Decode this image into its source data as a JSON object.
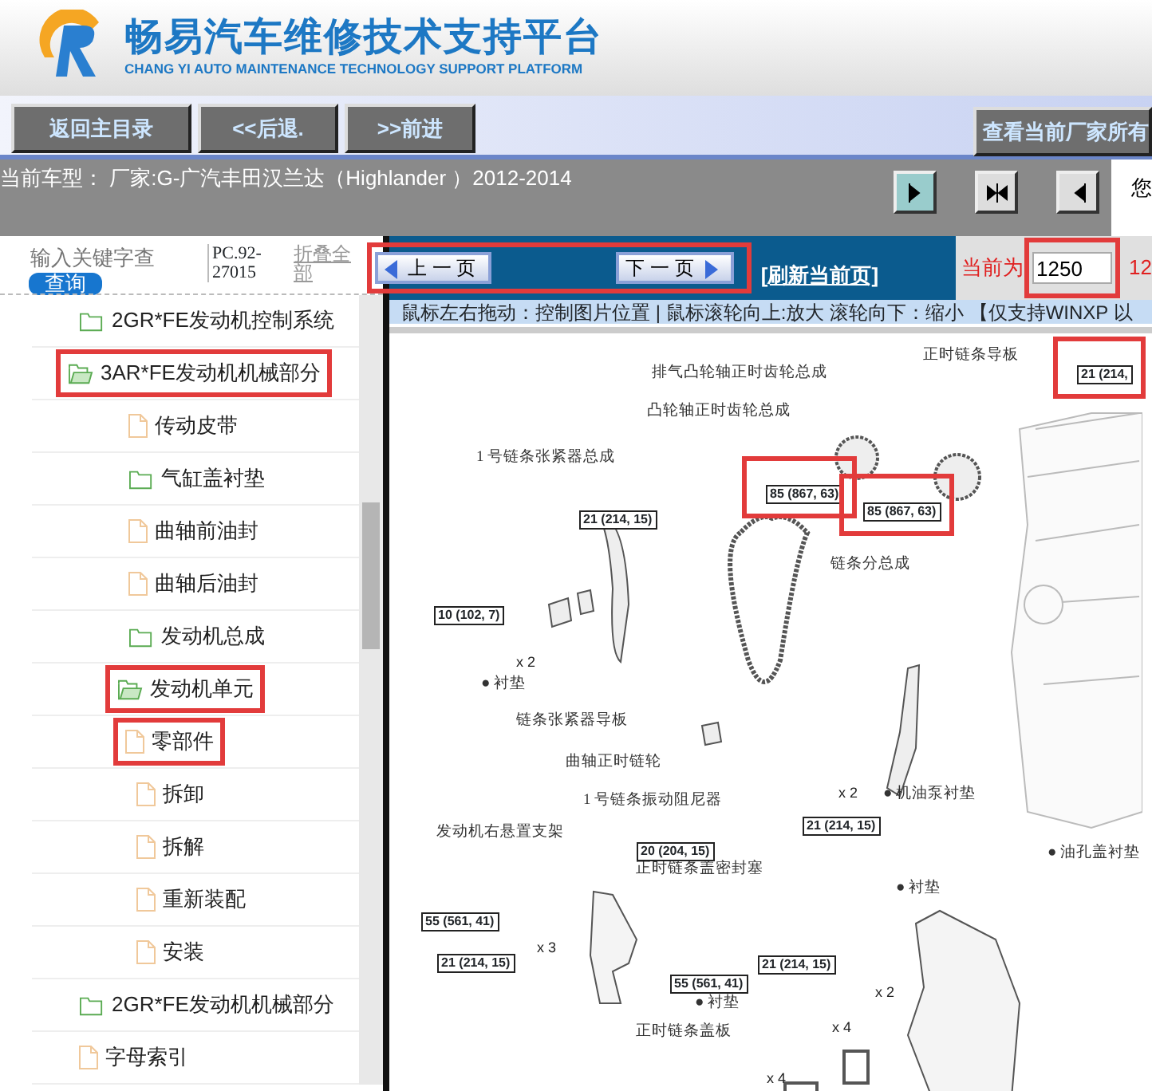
{
  "header": {
    "title": "畅易汽车维修技术支持平台",
    "subtitle": "CHANG YI AUTO MAINTENANCE TECHNOLOGY SUPPORT PLATFORM"
  },
  "toolbar": {
    "buttons": [
      "返回主目录",
      "<<后退.",
      ">>前进"
    ],
    "right_button": "查看当前厂家所有"
  },
  "vehicle_bar": {
    "text": "当前车型： 厂家:G-广汽丰田汉兰达（Highlander ）2012-2014",
    "trailing": "您"
  },
  "sidebar": {
    "search": {
      "placeholder": "输入关键字查",
      "button": "查询"
    },
    "code": "PC.92-27015",
    "collapse": "折叠全部",
    "tree": [
      {
        "label": "2GR*FE发动机控制系统",
        "kind": "folder",
        "expanded": false,
        "highlighted": false
      },
      {
        "label": "3AR*FE发动机机械部分",
        "kind": "folder",
        "expanded": true,
        "highlighted": true,
        "children": [
          {
            "label": "传动皮带",
            "kind": "file",
            "highlighted": false
          },
          {
            "label": "气缸盖衬垫",
            "kind": "folder",
            "expanded": false,
            "highlighted": false
          },
          {
            "label": "曲轴前油封",
            "kind": "file",
            "highlighted": false
          },
          {
            "label": "曲轴后油封",
            "kind": "file",
            "highlighted": false
          },
          {
            "label": "发动机总成",
            "kind": "folder",
            "expanded": false,
            "highlighted": false
          },
          {
            "label": "发动机单元",
            "kind": "folder",
            "expanded": true,
            "highlighted": true,
            "children": [
              {
                "label": "零部件",
                "kind": "file",
                "highlighted": true
              },
              {
                "label": "拆卸",
                "kind": "file",
                "highlighted": false
              },
              {
                "label": "拆解",
                "kind": "file",
                "highlighted": false
              },
              {
                "label": "重新装配",
                "kind": "file",
                "highlighted": false
              },
              {
                "label": "安装",
                "kind": "file",
                "highlighted": false
              }
            ]
          }
        ]
      },
      {
        "label": "2GR*FE发动机机械部分",
        "kind": "folder",
        "expanded": false,
        "highlighted": false
      },
      {
        "label": "字母索引",
        "kind": "file",
        "highlighted": false
      }
    ]
  },
  "viewer": {
    "nav": {
      "prev": "上 一 页",
      "next": "下 一 页",
      "highlighted": true
    },
    "refresh": "[刷新当前页]",
    "page": {
      "label": "当前为",
      "value": "1250",
      "highlighted": true,
      "total": "12"
    },
    "hint": "鼠标左右拖动：控制图片位置 | 鼠标滚轮向上:放大   滚轮向下：缩小 【仅支持WINXP 以",
    "diagram": {
      "labels": [
        {
          "text": "正时链条导板"
        },
        {
          "text": "排气凸轮轴正时齿轮总成"
        },
        {
          "text": "凸轮轴正时齿轮总成"
        },
        {
          "text": "1 号链条张紧器总成"
        },
        {
          "text": "链条分总成"
        },
        {
          "text": "● 衬垫"
        },
        {
          "text": "链条张紧器导板"
        },
        {
          "text": "曲轴正时链轮"
        },
        {
          "text": "1 号链条振动阻尼器"
        },
        {
          "text": "● 机油泵衬垫"
        },
        {
          "text": "● 油孔盖衬垫"
        },
        {
          "text": "发动机右悬置支架"
        },
        {
          "text": "正时链条盖密封塞"
        },
        {
          "text": "● 衬垫"
        },
        {
          "text": "● 衬垫"
        },
        {
          "text": "正时链条盖板"
        }
      ],
      "callouts": [
        {
          "text": "21 (214,",
          "kind": "torque",
          "highlighted": true
        },
        {
          "text": "85 (867, 63)",
          "kind": "torque",
          "highlighted": true
        },
        {
          "text": "85 (867, 63)",
          "kind": "torque",
          "highlighted": true
        },
        {
          "text": "21 (214, 15)",
          "kind": "torque",
          "highlighted": false
        },
        {
          "text": "10 (102, 7)",
          "kind": "torque",
          "highlighted": false
        },
        {
          "text": "x 2",
          "kind": "count",
          "highlighted": false
        },
        {
          "text": "x 2",
          "kind": "count",
          "highlighted": false
        },
        {
          "text": "21 (214, 15)",
          "kind": "torque",
          "highlighted": false
        },
        {
          "text": "20 (204, 15)",
          "kind": "torque",
          "highlighted": false
        },
        {
          "text": "55 (561, 41)",
          "kind": "torque",
          "highlighted": false
        },
        {
          "text": "x 3",
          "kind": "count",
          "highlighted": false
        },
        {
          "text": "21 (214, 15)",
          "kind": "torque",
          "highlighted": false
        },
        {
          "text": "21 (214, 15)",
          "kind": "torque",
          "highlighted": false
        },
        {
          "text": "x 2",
          "kind": "count",
          "highlighted": false
        },
        {
          "text": "55 (561, 41)",
          "kind": "torque",
          "highlighted": false
        },
        {
          "text": "x 4",
          "kind": "count",
          "highlighted": false
        },
        {
          "text": "x 4",
          "kind": "count",
          "highlighted": false
        }
      ]
    }
  }
}
